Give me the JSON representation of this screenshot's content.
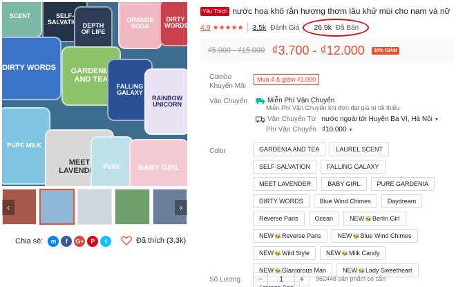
{
  "product": {
    "badge": "Yêu Thích",
    "title": "nước hoa khô rắn hương thơm lâu khử mùi cho nam và nữ",
    "rating": "4.9",
    "reviews_count": "3,5k",
    "reviews_label": "Đánh Giá",
    "sold_count": "26,9k",
    "sold_label": "Đã Bán"
  },
  "price": {
    "old": "₫5.000 - ₫15.000",
    "new": "₫3.700 - ₫12.000",
    "discount": "30% GIẢM"
  },
  "combo": {
    "label": "Combo Khuyến Mãi",
    "tag": "Mua 4 & giảm ₫1.000"
  },
  "shipping": {
    "label": "Vận Chuyển",
    "free": "Miễn Phí Vận Chuyển",
    "free_sub": "Miễn Phí Vận Chuyển khi đơn đạt giá trị tối thiểu",
    "from_label": "Vận Chuyển Từ",
    "from_value": "nước ngoài tới Huyện Ba Vì, Hà Nội",
    "fee_label": "Phí Vận Chuyển",
    "fee_value": "₫10.000"
  },
  "color": {
    "label": "Color",
    "bee": "🐝",
    "options": [
      {
        "pre": "",
        "name": "GARDENIA AND TEA"
      },
      {
        "pre": "",
        "name": "LAUREL SCENT"
      },
      {
        "pre": "",
        "name": "SELF-SALVATION"
      },
      {
        "pre": "",
        "name": "FALLING GALAXY"
      },
      {
        "pre": "",
        "name": "MEET LAVENDER"
      },
      {
        "pre": "",
        "name": "BABY GIRL"
      },
      {
        "pre": "",
        "name": "PURE GARDENIA"
      },
      {
        "pre": "",
        "name": "DIRTY WORDS"
      },
      {
        "pre": "",
        "name": "Blue Wind Chimes"
      },
      {
        "pre": "",
        "name": "Daydream"
      },
      {
        "pre": "",
        "name": "Reverse Paris"
      },
      {
        "pre": "",
        "name": "Ocean"
      },
      {
        "pre": "NEW",
        "name": "Berlin Girl"
      },
      {
        "pre": "NEW",
        "name": "Reverse Paris"
      },
      {
        "pre": "NEW",
        "name": "Blue Wind Chimes"
      },
      {
        "pre": "NEW",
        "name": "Wild Style"
      },
      {
        "pre": "NEW",
        "name": "Milk Candy"
      },
      {
        "pre": "NEW",
        "name": "Glamorous Man"
      },
      {
        "pre": "NEW",
        "name": "Lady Sweetheart"
      },
      {
        "pre": "",
        "name": "Storage Bag"
      }
    ]
  },
  "quantity": {
    "label": "Số Lượng",
    "value": "1",
    "minus": "−",
    "plus": "+",
    "stock": "962448 sản phẩm có sẵn"
  },
  "share": {
    "label": "Chia sẻ:",
    "icons": [
      {
        "name": "messenger-icon",
        "glyph": "m",
        "color": "#0084ff"
      },
      {
        "name": "facebook-icon",
        "glyph": "f",
        "color": "#3b5999"
      },
      {
        "name": "google-icon",
        "glyph": "G+",
        "color": "#db4437"
      },
      {
        "name": "pinterest-icon",
        "glyph": "P",
        "color": "#de0217"
      },
      {
        "name": "twitter-icon",
        "glyph": "t",
        "color": "#10c2ff"
      }
    ]
  },
  "like": {
    "label": "Đã thích (3,3k)"
  },
  "images": {
    "tins": [
      {
        "text": "SCENT",
        "bg": "#7ab9a4",
        "fg": "#ffffff"
      },
      {
        "text": "SELF-SALVATION",
        "bg": "#243447",
        "fg": "#ffffff"
      },
      {
        "text": "DEPTH OF LIFE",
        "bg": "#2e3c57",
        "fg": "#ffffff"
      },
      {
        "text": "ORANGE SODA",
        "bg": "#f1b8c3",
        "fg": "#ffffff"
      },
      {
        "text": "DIRTY WORDS",
        "bg": "#c9414d",
        "fg": "#ffffff"
      },
      {
        "text": "DIRTY WORDS",
        "bg": "#3c74c8",
        "fg": "#ffffff"
      },
      {
        "text": "GARDENIA AND TEA",
        "bg": "#8dc36a",
        "fg": "#ffffff"
      },
      {
        "text": "FALLING GALAXY",
        "bg": "#2a4f94",
        "fg": "#ffffff"
      },
      {
        "text": "RAINBOW UNICORN",
        "bg": "#e9e3f3",
        "fg": "#2c2c6c"
      },
      {
        "text": "PURE MILK",
        "bg": "#7fc4e0",
        "fg": "#ffffff"
      },
      {
        "text": "MEET LAVENDER",
        "bg": "#d8d8d8",
        "fg": "#333333"
      },
      {
        "text": "PURE",
        "bg": "#bfe2ea",
        "fg": "#ffffff"
      },
      {
        "text": "BABY GIRL",
        "bg": "#f3c9d3",
        "fg": "#ffffff"
      }
    ],
    "thumbs": [
      {
        "bg": "#a6594b"
      },
      {
        "bg": "#8fb7d8"
      },
      {
        "bg": "#cfd6dd"
      },
      {
        "bg": "#6f9f6a"
      },
      {
        "bg": "#6b7e9a"
      }
    ]
  }
}
